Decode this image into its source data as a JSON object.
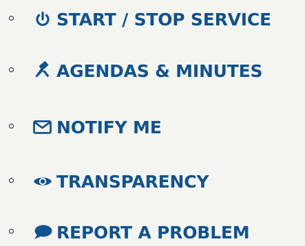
{
  "menu": {
    "items": [
      {
        "label": "START / STOP SERVICE",
        "icon": "power-icon"
      },
      {
        "label": "AGENDAS & MINUTES",
        "icon": "gavel-icon"
      },
      {
        "label": "NOTIFY ME",
        "icon": "envelope-icon"
      },
      {
        "label": "TRANSPARENCY",
        "icon": "eye-icon"
      },
      {
        "label": "REPORT A PROBLEM",
        "icon": "comment-icon"
      }
    ]
  },
  "colors": {
    "background": "#f4f5f1",
    "link": "#11538d",
    "bullet": "#1d1f22"
  }
}
